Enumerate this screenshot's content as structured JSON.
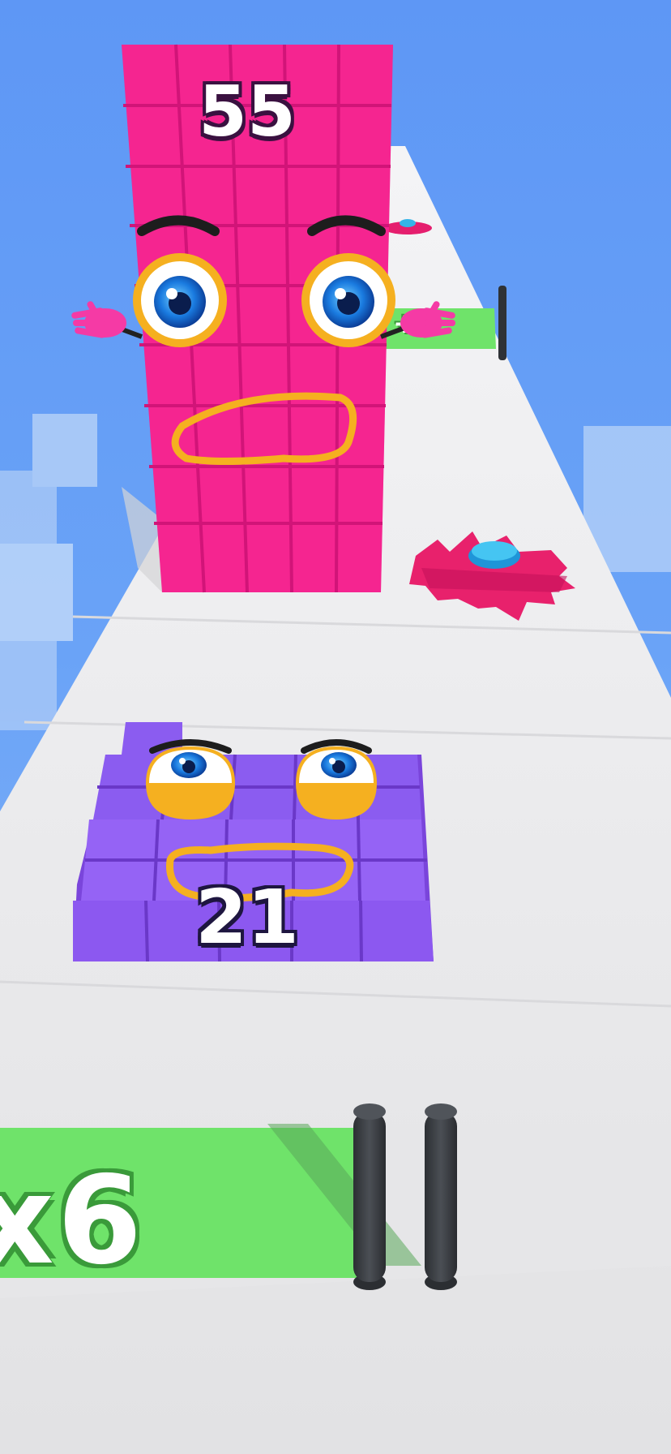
{
  "player_character": {
    "value": "21",
    "color": "#8b5cf0"
  },
  "enemy_character": {
    "value": "55",
    "color": "#f0288c"
  },
  "gates": [
    {
      "label": "x6",
      "color": "#6fe36a"
    },
    {
      "label": "+",
      "color": "#6fe36a"
    }
  ],
  "hazards": [
    "saw-blade",
    "saw-blade-far"
  ],
  "colors": {
    "sky": "#5e97f5",
    "track": "#eeeeee",
    "gate": "#6fe36a",
    "pole": "#3a3d40"
  }
}
